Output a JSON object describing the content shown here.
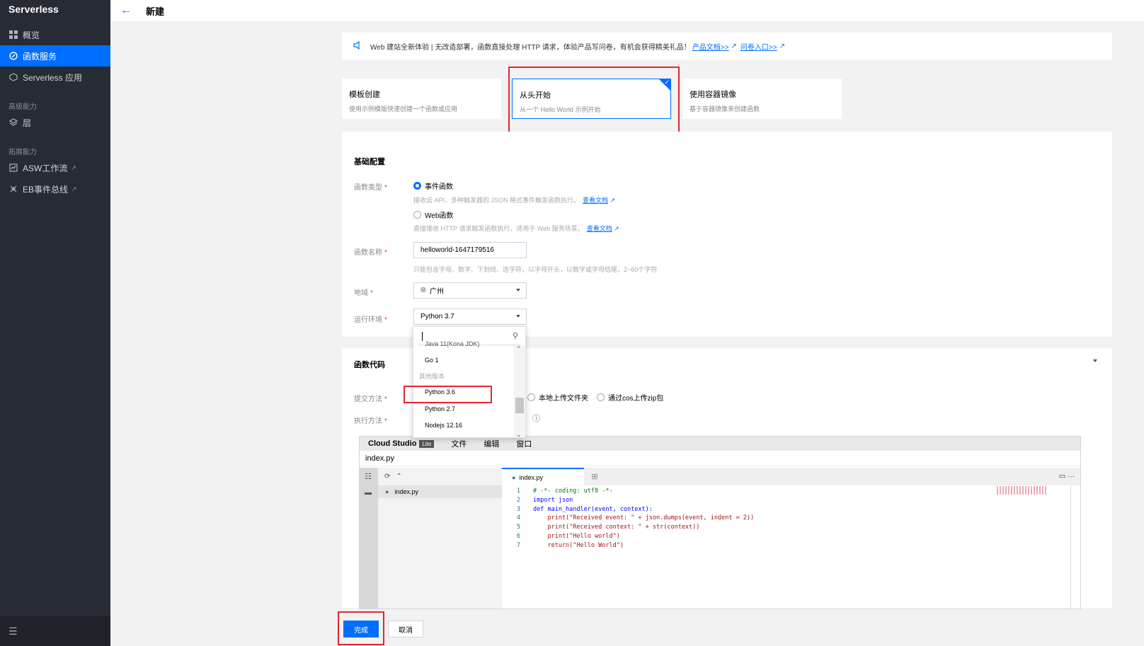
{
  "sidebar": {
    "brand": "Serverless",
    "items": [
      {
        "label": "概览"
      },
      {
        "label": "函数服务"
      },
      {
        "label": "Serverless 应用"
      }
    ],
    "group_advanced": "高级能力",
    "layer": "层",
    "group_extend": "拓展能力",
    "asw": "ASW工作流",
    "eb": "EB事件总线"
  },
  "header": {
    "title": "新建"
  },
  "notice": {
    "text": "Web 建站全新体验 | 无改造部署，函数直接处理 HTTP 请求，体验产品写问卷，有机会获得精美礼品！",
    "link1": "产品文档>>",
    "link2": "问卷入口>>"
  },
  "methods": [
    {
      "title": "模板创建",
      "desc": "使用示例模版快速创建一个函数或应用"
    },
    {
      "title": "从头开始",
      "desc": "从一个 Hello World 示例开始"
    },
    {
      "title": "使用容器镜像",
      "desc": "基于容器镜像来创建函数"
    }
  ],
  "basic": {
    "title": "基础配置",
    "type_label": "函数类型",
    "type_event": "事件函数",
    "type_event_hint": "接收云 API、多种触发器的 JSON 格式事件触发函数执行。",
    "type_web": "Web函数",
    "type_web_hint": "直接接收 HTTP 请求触发函数执行，适用于 Web 服务场景。",
    "doc_link": "查看文档",
    "name_label": "函数名称",
    "name_value": "helloworld-1647179516",
    "name_hint": "只能包含字母、数字、下划线、连字符，以字母开头，以数字或字母结尾，2~60个字符",
    "region_label": "地域",
    "region_value": "广州",
    "runtime_label": "运行环境",
    "runtime_value": "Python 3.7"
  },
  "dropdown": {
    "partial": "Java 11(Kona JDK)",
    "items_top": [
      "Go 1"
    ],
    "group": "其他版本",
    "items": [
      "Python 3.6",
      "Python 2.7",
      "Nodejs 12.16"
    ]
  },
  "code": {
    "title": "函数代码",
    "submit_label": "提交方法",
    "exec_label": "执行方法",
    "opt_local": "本地上传文件夹",
    "opt_cos": "通过cos上传zip包"
  },
  "ide": {
    "brand": "Cloud Studio",
    "lite": "Lite",
    "menu": [
      "文件",
      "编辑",
      "窗口"
    ],
    "path": "index.py",
    "file": "index.py",
    "tab": "index.py",
    "lines": [
      "# -*- coding: utf8 -*-",
      "import json",
      "def main_handler(event, context):",
      "    print(\"Received event: \" + json.dumps(event, indent = 2))",
      "    print(\"Received context: \" + str(context))",
      "    print(\"Hello world\")",
      "    return(\"Hello World\")"
    ]
  },
  "actions": {
    "done": "完成",
    "cancel": "取消"
  },
  "colors": {
    "accent": "#006eff",
    "sidebar": "#272b33",
    "highlight": "#e0272e"
  }
}
